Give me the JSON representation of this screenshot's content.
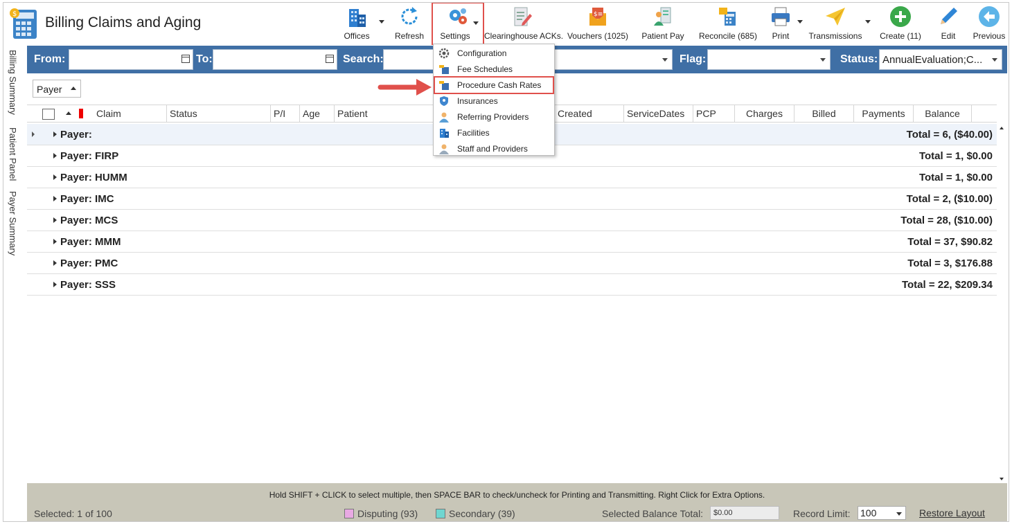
{
  "app": {
    "title": "Billing Claims and Aging"
  },
  "toolbar": {
    "offices": "Offices",
    "refresh": "Refresh",
    "settings": "Settings",
    "clearinghouse": "Clearinghouse ACKs.",
    "vouchers": "Vouchers (1025)",
    "patient_pay": "Patient Pay",
    "reconcile": "Reconcile (685)",
    "print": "Print",
    "transmissions": "Transmissions",
    "create": "Create (11)",
    "edit": "Edit",
    "previous": "Previous"
  },
  "filters": {
    "from_label": "From:",
    "to_label": "To:",
    "search_label": "Search:",
    "flag_label": "Flag:",
    "status_label": "Status:",
    "status_value": "AnnualEvaluation;C..."
  },
  "side_tabs": [
    "Billing Summary",
    "Patient Panel",
    "Payer Summary"
  ],
  "group_by": {
    "value": "Payer"
  },
  "columns": {
    "claim": "Claim",
    "status": "Status",
    "pi": "P/I",
    "age": "Age",
    "patient": "Patient",
    "created": "Created",
    "service_dates": "ServiceDates",
    "pcp": "PCP",
    "charges": "Charges",
    "billed": "Billed",
    "payments": "Payments",
    "balance": "Balance"
  },
  "groups": [
    {
      "name": "Payer:",
      "total": "Total = 6,  ($40.00)"
    },
    {
      "name": "Payer: FIRP",
      "total": "Total = 1,  $0.00"
    },
    {
      "name": "Payer: HUMM",
      "total": "Total = 1,  $0.00"
    },
    {
      "name": "Payer: IMC",
      "total": "Total = 2,  ($10.00)"
    },
    {
      "name": "Payer: MCS",
      "total": "Total = 28,  ($10.00)"
    },
    {
      "name": "Payer: MMM",
      "total": "Total = 37,  $90.82"
    },
    {
      "name": "Payer: PMC",
      "total": "Total = 3,  $176.88"
    },
    {
      "name": "Payer: SSS",
      "total": "Total = 22,  $209.34"
    }
  ],
  "settings_menu": [
    "Configuration",
    "Fee Schedules",
    "Procedure Cash Rates",
    "Insurances",
    "Referring Providers",
    "Facilities",
    "Staff and Providers"
  ],
  "statusbar": {
    "hint": "Hold SHIFT + CLICK to select multiple, then SPACE BAR to check/uncheck for Printing and Transmitting. Right Click for Extra Options.",
    "selected": "Selected: 1 of 100",
    "disputing": "Disputing (93)",
    "secondary": "Secondary (39)",
    "selected_balance_label": "Selected Balance Total:",
    "selected_balance_value": "$0.00",
    "record_limit_label": "Record Limit:",
    "record_limit_value": "100",
    "restore_layout": "Restore Layout"
  },
  "colors": {
    "filter_bar": "#3f6fa5",
    "highlight": "#e0504b",
    "disputing": "#e9a9e3",
    "secondary": "#6fd6d0",
    "status_bar": "#c8c6b8"
  }
}
